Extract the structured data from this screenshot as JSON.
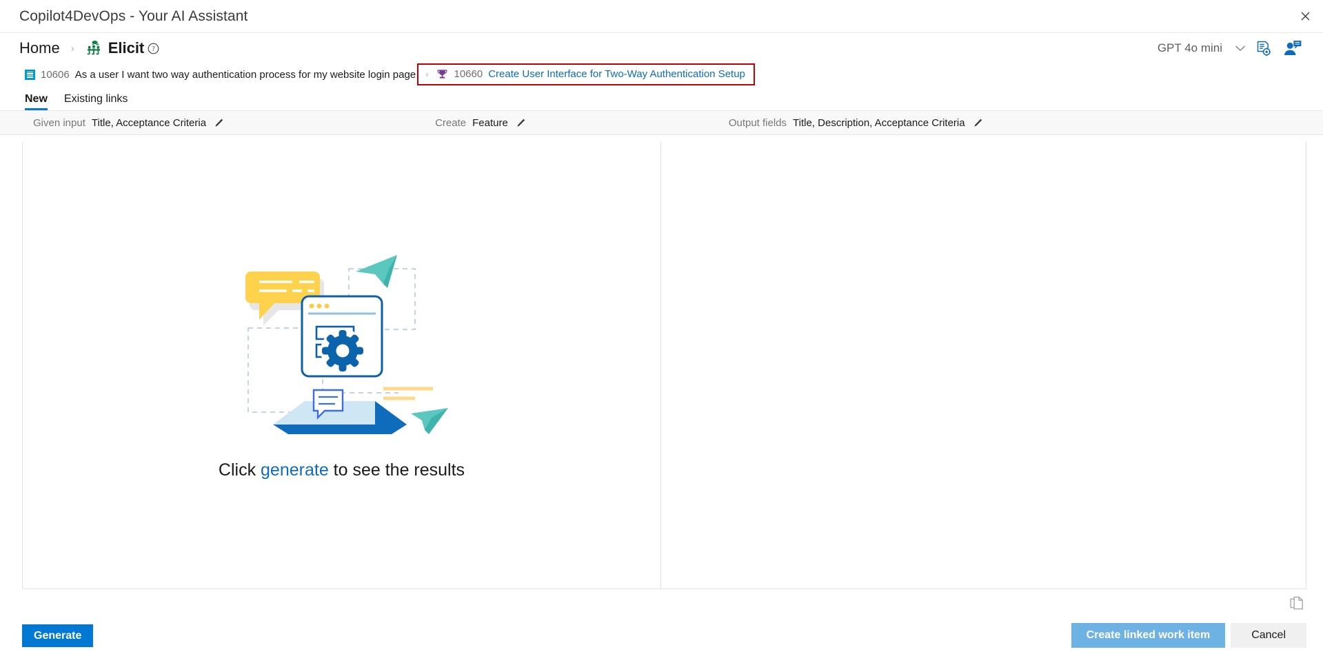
{
  "window": {
    "title": "Copilot4DevOps - Your AI Assistant",
    "close_icon": "close-icon"
  },
  "breadcrumb": {
    "home_label": "Home",
    "separator": "›",
    "current_label": "Elicit",
    "current_icon": "elicit-people-icon",
    "help_icon": "help-circle-icon"
  },
  "header_tools": {
    "model_label": "GPT 4o mini",
    "model_chevron_icon": "chevron-down-icon",
    "prompt_settings_icon": "document-settings-icon",
    "persona_icon": "person-chat-icon"
  },
  "work_items": {
    "source": {
      "icon": "user-story-icon",
      "id": "10606",
      "title": "As a user I want two way authentication process for my website login page"
    },
    "arrow": "›",
    "target": {
      "icon": "feature-trophy-icon",
      "id": "10660",
      "title": "Create User Interface for Two-Way Authentication Setup",
      "highlight_color": "#c00000"
    }
  },
  "tabs": [
    {
      "label": "New",
      "active": true
    },
    {
      "label": "Existing links",
      "active": false
    }
  ],
  "meta": {
    "given_input": {
      "label": "Given input",
      "value": "Title, Acceptance Criteria",
      "edit_icon": "pencil-icon"
    },
    "create": {
      "label": "Create",
      "value": "Feature",
      "edit_icon": "pencil-icon"
    },
    "output_fields": {
      "label": "Output fields",
      "value": "Title, Description, Acceptance Criteria",
      "edit_icon": "pencil-icon"
    }
  },
  "empty_state": {
    "illustration_name": "generate-results-illustration",
    "text_before": "Click ",
    "text_link": "generate",
    "text_after": " to see the results"
  },
  "copy": {
    "icon": "copy-pages-icon"
  },
  "footer": {
    "generate_label": "Generate",
    "create_linked_label": "Create linked work item",
    "cancel_label": "Cancel"
  },
  "colors": {
    "accent": "#0078d4",
    "link": "#0f6cbd",
    "highlight": "#c00000",
    "disabled_primary": "#6cb3e4",
    "story_icon": "#009ccc",
    "feature_icon": "#773b93",
    "elicit_icon": "#107c41"
  }
}
